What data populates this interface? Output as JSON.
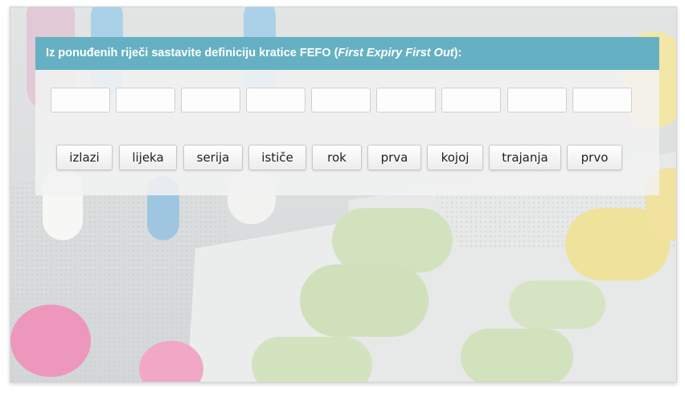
{
  "header": {
    "prefix": "Iz ponuđenih riječi sastavite definiciju kratice FEFO (",
    "italic": "First Expiry First Out",
    "suffix": "):"
  },
  "slots_count": 9,
  "words": [
    "izlazi",
    "lijeka",
    "serija",
    "ističe",
    "rok",
    "prva",
    "kojoj",
    "trajanja",
    "prvo"
  ],
  "background": {
    "description_icon": "pills-blister-photo",
    "tint": "#eef0ee"
  },
  "colors": {
    "header_bg": "#65b1c3",
    "header_text": "#ffffff"
  }
}
